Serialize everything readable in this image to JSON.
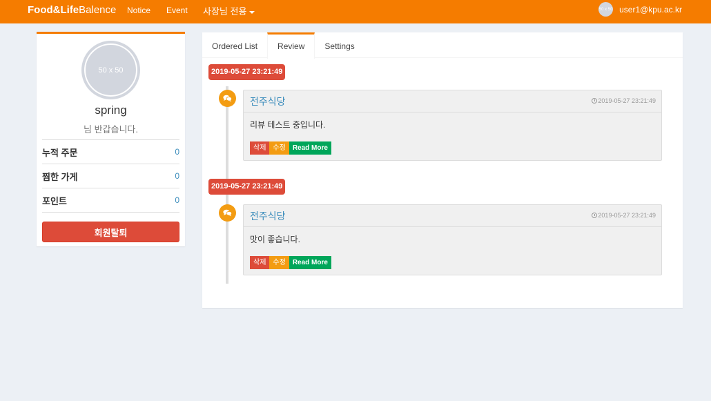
{
  "navbar": {
    "brand_bold": "Food&Life",
    "brand_rest": "Balence",
    "notice": "Notice",
    "event": "Event",
    "owner_menu": "사장님 전용",
    "user_email": "user1@kpu.ac.kr",
    "avatar_placeholder": "50 x 50"
  },
  "profile": {
    "avatar_placeholder": "50 x 50",
    "name": "spring",
    "greeting": "님 반갑습니다.",
    "stats": [
      {
        "label": "누적 주문",
        "value": "0"
      },
      {
        "label": "찜한 가게",
        "value": "0"
      },
      {
        "label": "포인트",
        "value": "0"
      }
    ],
    "withdraw_label": "회원탈퇴"
  },
  "tabs": [
    {
      "label": "Ordered List",
      "active": false
    },
    {
      "label": "Review",
      "active": true
    },
    {
      "label": "Settings",
      "active": false
    }
  ],
  "reviews": [
    {
      "date_label": "2019-05-27 23:21:49",
      "store": "전주식당",
      "time": "2019-05-27 23:21:49",
      "body": "리뷰 테스트 중입니다.",
      "delete_label": "삭제",
      "edit_label": "수정",
      "more_label": "Read More"
    },
    {
      "date_label": "2019-05-27 23:21:49",
      "store": "전주식당",
      "time": "2019-05-27 23:21:49",
      "body": "맛이 좋습니다.",
      "delete_label": "삭제",
      "edit_label": "수정",
      "more_label": "Read More"
    }
  ],
  "colors": {
    "accent": "#f57c00",
    "danger": "#dd4b39",
    "warning": "#f39c12",
    "success": "#00a65a",
    "link": "#3c8dbc"
  },
  "icons": {
    "timeline": "comments-icon",
    "time": "clock-icon"
  }
}
